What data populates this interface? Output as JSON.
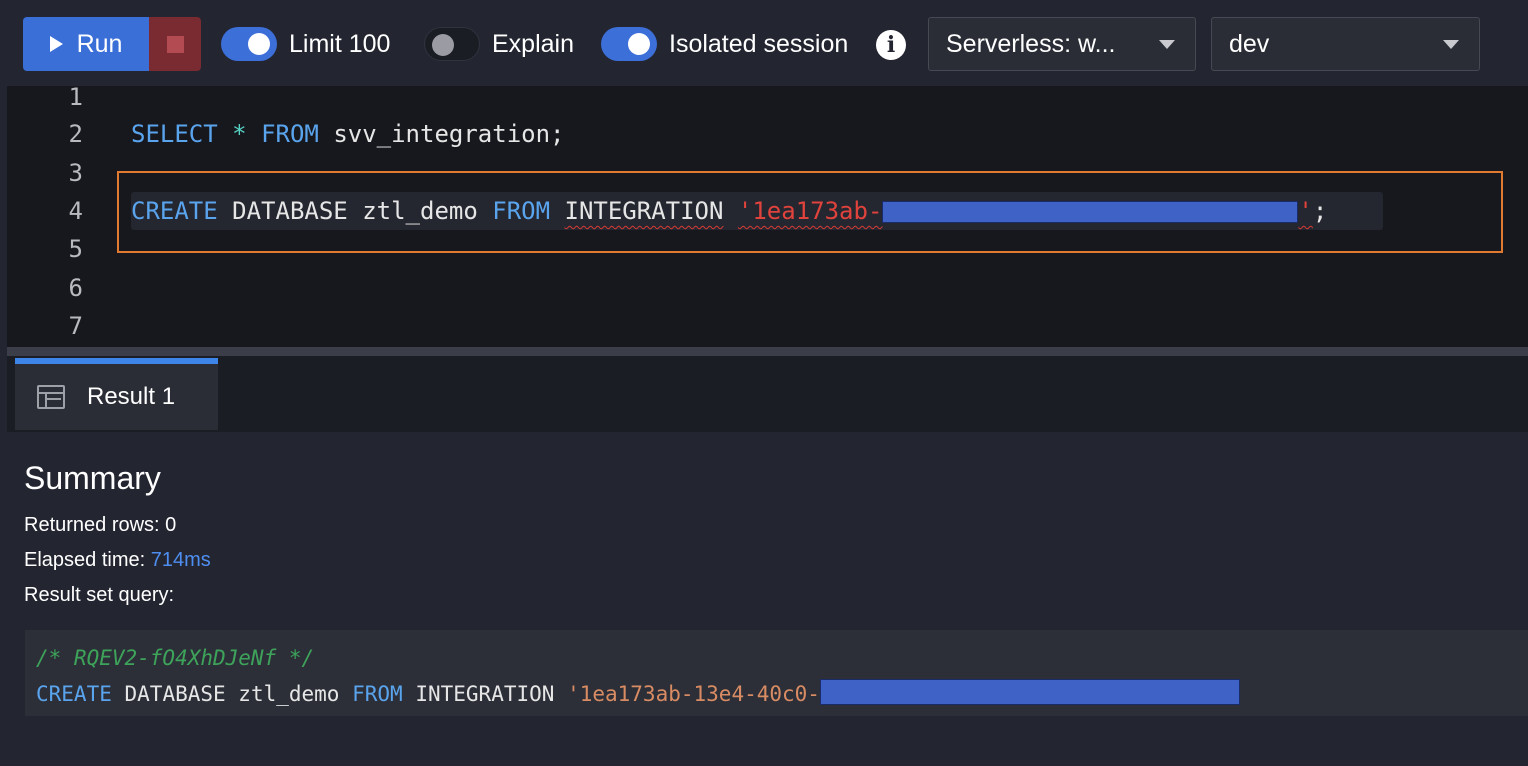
{
  "toolbar": {
    "run_label": "Run",
    "limit_label": "Limit 100",
    "limit_on": true,
    "explain_label": "Explain",
    "explain_on": false,
    "isolated_label": "Isolated session",
    "isolated_on": true,
    "workgroup_value": "Serverless: w...",
    "database_value": "dev"
  },
  "editor": {
    "line_numbers": [
      "1",
      "2",
      "3",
      "4",
      "5",
      "6",
      "7"
    ],
    "line2": {
      "kw1": "SELECT",
      "op": "*",
      "kw2": "FROM",
      "rest": "svv_integration;"
    },
    "line4": {
      "kw1": "CREATE",
      "t1": "DATABASE",
      "t2": "ztl_demo",
      "kw2": "FROM",
      "t3": "INTEGRATION",
      "str_start": "'1ea173ab-",
      "str_end": "'",
      "terminator": ";"
    }
  },
  "results": {
    "tab_label": "Result 1",
    "summary_title": "Summary",
    "returned_rows_label": "Returned rows: 0",
    "elapsed_label": "Elapsed time: ",
    "elapsed_value": "714ms",
    "result_set_query_label": "Result set query:",
    "query_comment": "/* RQEV2-fO4XhDJeNf */",
    "query": {
      "kw1": "CREATE",
      "t1": "DATABASE ztl_demo",
      "kw2": "FROM",
      "t2": "INTEGRATION",
      "str": "'1ea173ab-13e4-40c0-"
    }
  },
  "colors": {
    "accent": "#3a6fd8",
    "highlight_box": "#e27931",
    "keyword": "#5aa4ee",
    "string_error": "#e0423c",
    "redaction": "#3e62c6"
  }
}
